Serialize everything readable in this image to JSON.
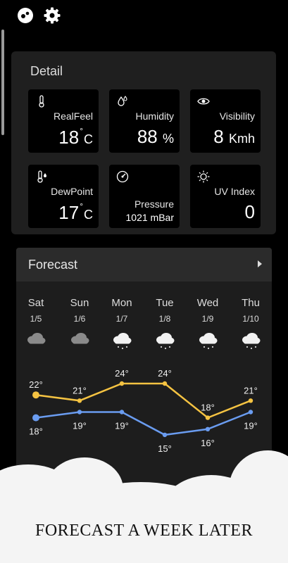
{
  "top_icons": {
    "left": "palette-icon",
    "right": "gear-icon"
  },
  "detail": {
    "title": "Detail",
    "cards": [
      {
        "icon": "thermometer-icon",
        "label": "RealFeel",
        "value": "18",
        "unit": "C",
        "deg": "°"
      },
      {
        "icon": "humidity-icon",
        "label": "Humidity",
        "value": "88",
        "unit": "%"
      },
      {
        "icon": "eye-icon",
        "label": "Visibility",
        "value": "8",
        "unit": "Kmh"
      },
      {
        "icon": "dewpoint-icon",
        "label": "DewPoint",
        "value": "17",
        "unit": "C",
        "deg": "°"
      },
      {
        "icon": "gauge-icon",
        "label": "Pressure",
        "value": "1021 mBar"
      },
      {
        "icon": "sun-icon",
        "label": "UV Index",
        "value": "0"
      }
    ]
  },
  "forecast": {
    "title": "Forecast",
    "days": [
      {
        "day": "Sat",
        "date": "1/5",
        "icon": "cloudy-icon",
        "high": "22°",
        "low": "18°"
      },
      {
        "day": "Sun",
        "date": "1/6",
        "icon": "cloudy-icon",
        "high": "21°",
        "low": "19°"
      },
      {
        "day": "Mon",
        "date": "1/7",
        "icon": "snow-icon",
        "high": "24°",
        "low": "19°"
      },
      {
        "day": "Tue",
        "date": "1/8",
        "icon": "snow-icon",
        "high": "24°",
        "low": "15°"
      },
      {
        "day": "Wed",
        "date": "1/9",
        "icon": "snow-icon",
        "high": "18°",
        "low": "16°"
      },
      {
        "day": "Thu",
        "date": "1/10",
        "icon": "snow-icon",
        "high": "21°",
        "low": "19°"
      }
    ]
  },
  "chart_data": {
    "type": "line",
    "categories": [
      "Sat",
      "Sun",
      "Mon",
      "Tue",
      "Wed",
      "Thu"
    ],
    "series": [
      {
        "values": [
          22,
          21,
          24,
          24,
          18,
          21
        ],
        "color": "#f5c342"
      },
      {
        "values": [
          18,
          19,
          19,
          15,
          16,
          19
        ],
        "color": "#6a9cf0"
      }
    ]
  },
  "caption": "FORECAST A WEEK LATER",
  "colors": {
    "background": "#000000",
    "panel": "#1f1f1f",
    "high_line": "#f5c342",
    "low_line": "#6a9cf0"
  }
}
